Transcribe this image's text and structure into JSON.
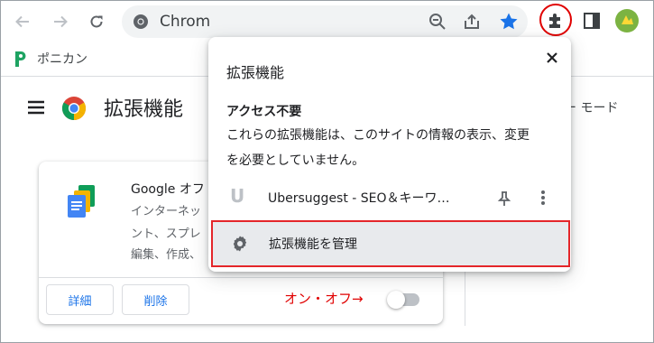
{
  "toolbar": {
    "back_icon": "arrow-left-icon",
    "forward_icon": "arrow-right-icon",
    "reload_icon": "reload-icon",
    "address_text": "Chrom",
    "colors": {
      "star": "#1a73e8",
      "highlight": "#e00000"
    }
  },
  "bookmarks": {
    "items": [
      {
        "label": "ポニカン",
        "icon": "p-logo-icon",
        "color": "#1ea362"
      }
    ]
  },
  "page": {
    "title": "拡張機能",
    "right_mode_text": "ー モード",
    "card": {
      "title": "Google オフ",
      "desc_lines": [
        "インターネッ",
        "ント、スプレ",
        "編集、作成、"
      ],
      "details_button": "詳細",
      "remove_button": "削除",
      "annotation": "オン・オフ→",
      "toggle_state": "off"
    }
  },
  "popup": {
    "title": "拡張機能",
    "section_heading": "アクセス不要",
    "desc_line1": "これらの拡張機能は、このサイトの情報の表示、変更",
    "desc_line2": "を必要としていません。",
    "extension": {
      "letter": "U",
      "name": "Ubersuggest - SEO＆キーワ…"
    },
    "manage_label": "拡張機能を管理",
    "highlight_color": "#e4262a"
  }
}
